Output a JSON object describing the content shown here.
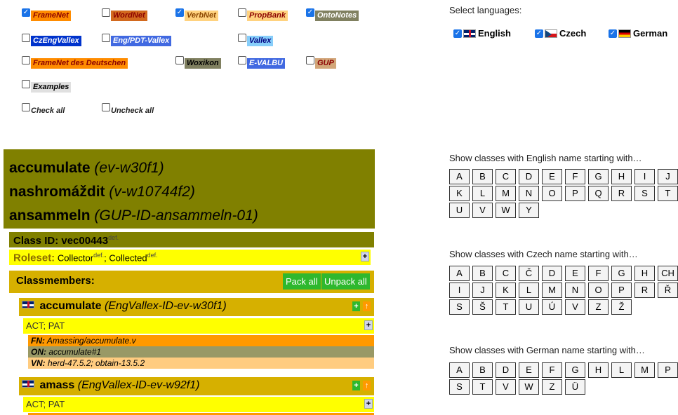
{
  "sources": {
    "row1": [
      {
        "label": "FrameNet",
        "checked": true,
        "bg": "#ff8c00",
        "color": "#8b0000"
      },
      {
        "label": "WordNet",
        "checked": false,
        "bg": "#d2691e",
        "color": "#8b0000"
      },
      {
        "label": "VerbNet",
        "checked": true,
        "bg": "#ffd27f",
        "color": "#8b4500"
      },
      {
        "label": "PropBank",
        "checked": false,
        "bg": "#ffd27f",
        "color": "#8b0000"
      },
      {
        "label": "OntoNotes",
        "checked": true,
        "bg": "#808060",
        "color": "#ffffff"
      }
    ],
    "row2": [
      {
        "label": "CzEngVallex",
        "checked": false,
        "bg": "#0033cc",
        "color": "#ffffff"
      },
      {
        "label": "Eng/PDT-Vallex",
        "checked": false,
        "bg": "#4169e1",
        "color": "#ffffff"
      },
      {
        "label": "Vallex",
        "checked": false,
        "bg": "#87cefa",
        "color": "#000080"
      }
    ],
    "row3": [
      {
        "label": "FrameNet des Deutschen",
        "checked": false,
        "bg": "#ff8c00",
        "color": "#8b0000"
      },
      {
        "label": "Woxikon",
        "checked": false,
        "bg": "#808060",
        "color": "#000000"
      },
      {
        "label": "E-VALBU",
        "checked": false,
        "bg": "#4169e1",
        "color": "#ffffff"
      },
      {
        "label": "GUP",
        "checked": false,
        "bg": "#d2a679",
        "color": "#8b0000"
      }
    ],
    "examples": {
      "label": "Examples",
      "checked": false,
      "bg": "#e0e0e0",
      "color": "#000000"
    },
    "check_all": "Check all",
    "uncheck_all": "Uncheck all"
  },
  "languages": {
    "title": "Select languages:",
    "items": [
      {
        "label": "English",
        "checked": true,
        "flag": "uk-flag-icon"
      },
      {
        "label": "Czech",
        "checked": true,
        "flag": "czech-flag-icon"
      },
      {
        "label": "German",
        "checked": true,
        "flag": "german-flag-icon"
      }
    ]
  },
  "entry": {
    "headwords": [
      {
        "lemma": "accumulate",
        "id": "(ev-w30f1)"
      },
      {
        "lemma": "nashromáždit",
        "id": "(v-w10744f2)"
      },
      {
        "lemma": "ansammeln",
        "id": "(GUP-ID-ansammeln-01)"
      }
    ],
    "class_id_label": "Class ID: vec00443",
    "def": "def.",
    "roleset_label": "Roleset:",
    "roleset_roles": [
      "Collector",
      "Collected"
    ],
    "plus": "+",
    "classmembers_label": "Classmembers:",
    "pack_all": "Pack all",
    "unpack_all": "Unpack all",
    "members": [
      {
        "lemma": "accumulate",
        "id": "(EngVallex-ID-ev-w30f1)",
        "roles": "ACT; PAT",
        "mappings": [
          {
            "key": "FN:",
            "value": "Amassing/accumulate.v",
            "bg": "#ff9900"
          },
          {
            "key": "ON:",
            "value": "accumulate#1",
            "bg": "#999966"
          },
          {
            "key": "VN:",
            "value": "herd-47.5.2; obtain-13.5.2",
            "bg": "#ffcc80"
          }
        ]
      },
      {
        "lemma": "amass",
        "id": "(EngVallex-ID-ev-w92f1)",
        "roles": "ACT; PAT",
        "mappings": []
      }
    ]
  },
  "letter_groups": [
    {
      "title": "Show classes with English name starting with…",
      "rows": [
        [
          "A",
          "B",
          "C",
          "D",
          "E",
          "F",
          "G",
          "H",
          "I",
          "J"
        ],
        [
          "K",
          "L",
          "M",
          "N",
          "O",
          "P",
          "Q",
          "R",
          "S",
          "T"
        ],
        [
          "U",
          "V",
          "W",
          "Y"
        ]
      ]
    },
    {
      "title": "Show classes with Czech name starting with…",
      "rows": [
        [
          "A",
          "B",
          "C",
          "Č",
          "D",
          "E",
          "F",
          "G",
          "H",
          "CH"
        ],
        [
          "I",
          "J",
          "K",
          "L",
          "M",
          "N",
          "O",
          "P",
          "R",
          "Ř"
        ],
        [
          "S",
          "Š",
          "T",
          "U",
          "Ú",
          "V",
          "Z",
          "Ž"
        ]
      ]
    },
    {
      "title": "Show classes with German name starting with…",
      "rows": [
        [
          "A",
          "B",
          "D",
          "E",
          "F",
          "G",
          "H",
          "L",
          "M",
          "P"
        ],
        [
          "S",
          "T",
          "V",
          "W",
          "Z",
          "Ü"
        ]
      ]
    }
  ]
}
